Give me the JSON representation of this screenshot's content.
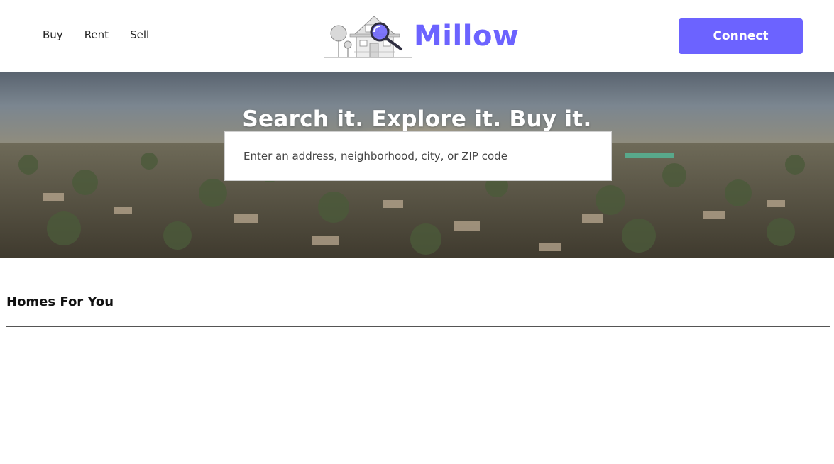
{
  "nav": {
    "items": [
      {
        "label": "Buy"
      },
      {
        "label": "Rent"
      },
      {
        "label": "Sell"
      }
    ]
  },
  "logo": {
    "brand": "Millow",
    "icon": "house-magnifier-icon"
  },
  "header": {
    "connect_label": "Connect"
  },
  "hero": {
    "title": "Search it. Explore it. Buy it.",
    "search_placeholder": "Enter an address, neighborhood, city, or ZIP code"
  },
  "homes": {
    "title": "Homes For You"
  },
  "colors": {
    "accent": "#6c63ff",
    "text": "#111111",
    "divider": "#555555"
  }
}
